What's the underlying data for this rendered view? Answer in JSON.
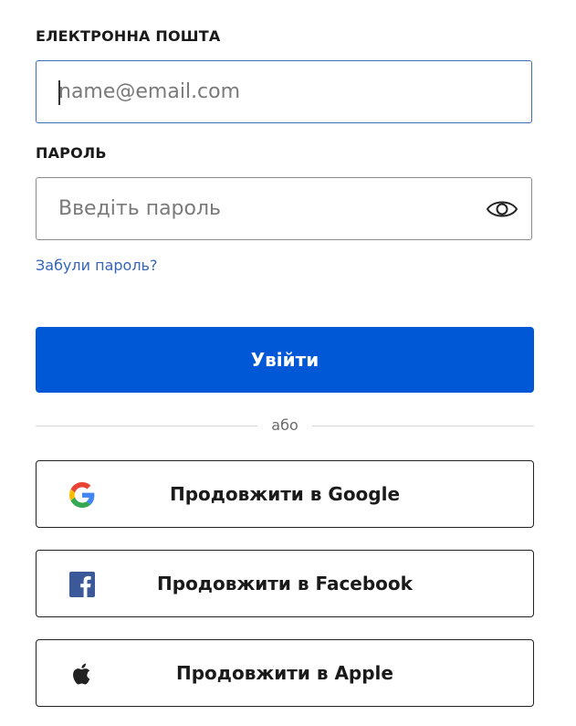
{
  "form": {
    "email_label": "ЕЛЕКТРОННА ПОШТА",
    "email_placeholder": "name@email.com",
    "email_value": "",
    "password_label": "ПАРОЛЬ",
    "password_placeholder": "Введіть пароль",
    "password_value": "",
    "show_password_icon": "eye-icon",
    "forgot_link": "Забули пароль?",
    "submit_label": "Увійти"
  },
  "divider": {
    "text": "або"
  },
  "social": [
    {
      "label": "Продовжити в Google",
      "icon": "google-icon"
    },
    {
      "label": "Продовжити в Facebook",
      "icon": "facebook-icon",
      "color": "#3b5998"
    },
    {
      "label": "Продовжити в Apple",
      "icon": "apple-icon"
    }
  ],
  "colors": {
    "primary": "#0058d6",
    "link": "#3565b8",
    "focus_border": "#3b6fb6"
  }
}
